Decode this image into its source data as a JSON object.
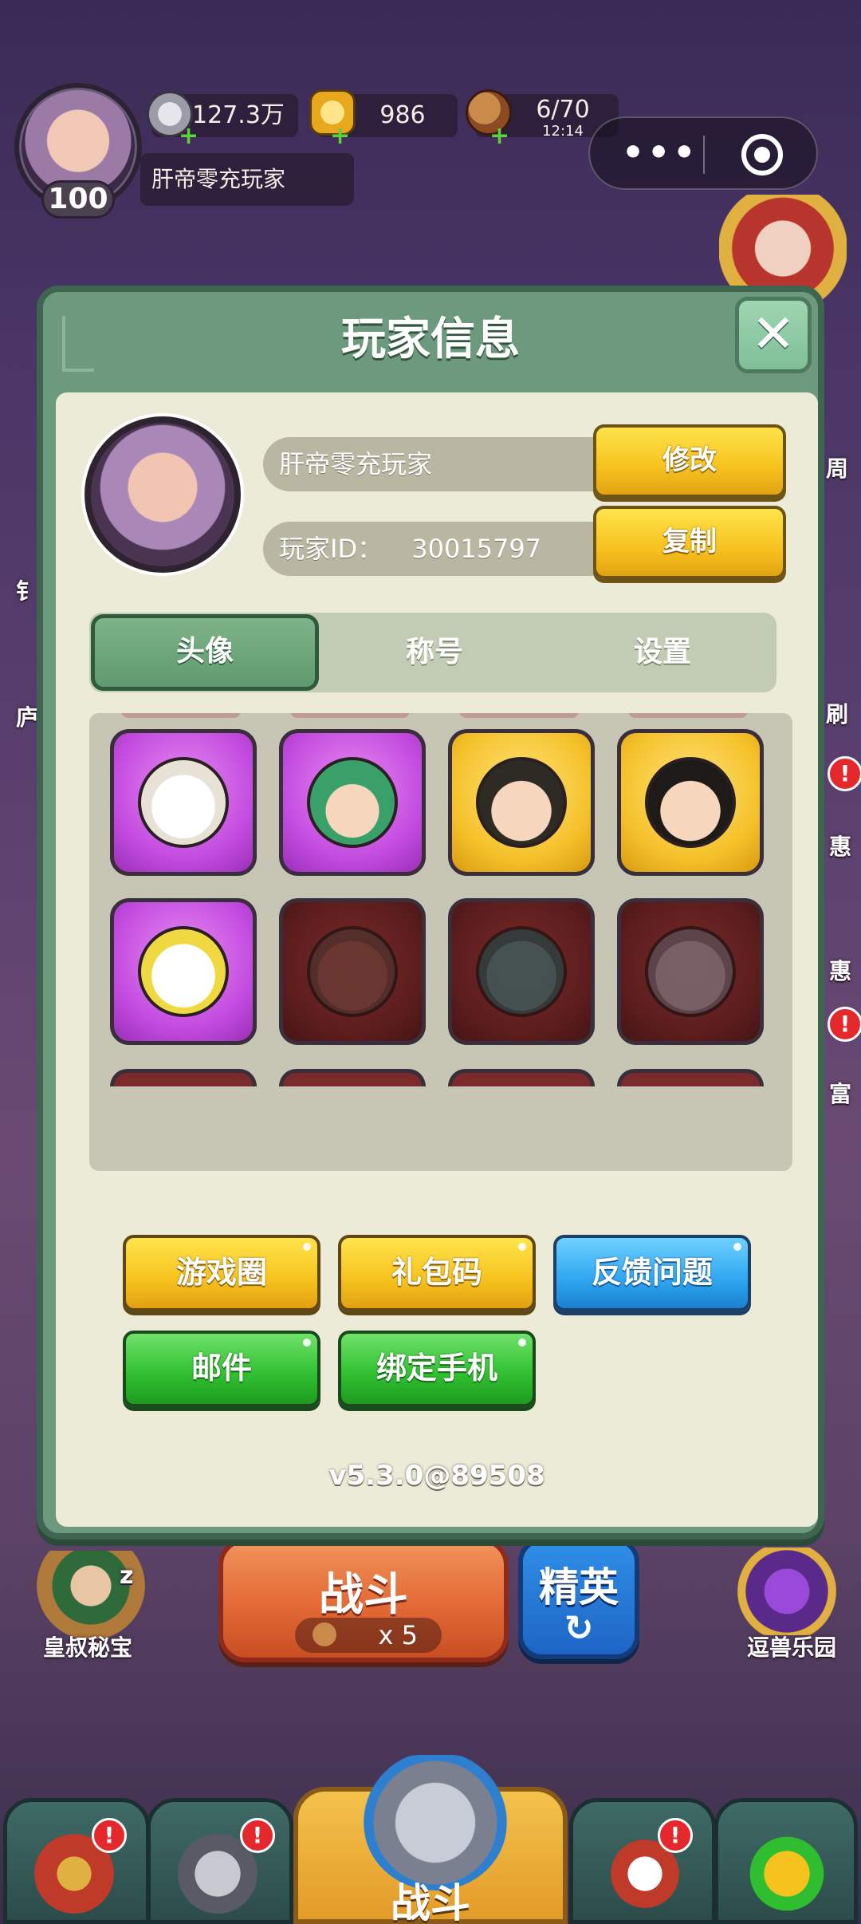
{
  "hud": {
    "level": "100",
    "player_name": "肝帝零充玩家",
    "silver": "127.3万",
    "gold": "986",
    "stamina": "6/70",
    "stamina_timer": "12:14"
  },
  "capsule": {
    "more_icon": "more-dots-icon",
    "close_icon": "target-circle-icon"
  },
  "side": {
    "left_bottom_label": "皇叔秘宝",
    "left_bottom_sleep": "z",
    "right_bottom_label": "逗兽乐园",
    "right_partial_1": "周",
    "right_partial_2": "刷",
    "right_partial_3": "惠",
    "right_partial_4": "惠",
    "right_partial_5": "富",
    "left_partial_1": "钅",
    "left_partial_2": "庐"
  },
  "modal": {
    "title": "玩家信息",
    "close_label": "✕",
    "profile": {
      "name": "肝帝零充玩家",
      "id_label": "玩家ID：",
      "id_value": "30015797",
      "modify_label": "修改",
      "copy_label": "复制"
    },
    "tabs": [
      {
        "label": "头像",
        "active": true
      },
      {
        "label": "称号",
        "active": false
      },
      {
        "label": "设置",
        "active": false
      }
    ],
    "avatars": [
      {
        "name": "goose-avatar",
        "rarity": "purple",
        "locked": false
      },
      {
        "name": "green-hood-avatar",
        "rarity": "purple",
        "locked": false
      },
      {
        "name": "headband-avatar",
        "rarity": "gold",
        "locked": false
      },
      {
        "name": "sunglasses-avatar",
        "rarity": "gold",
        "locked": false
      },
      {
        "name": "rabbit-avatar",
        "rarity": "purple",
        "locked": false
      },
      {
        "name": "warrior-avatar",
        "rarity": "red",
        "locked": true
      },
      {
        "name": "dragon-avatar",
        "rarity": "red",
        "locked": true
      },
      {
        "name": "king-avatar",
        "rarity": "red",
        "locked": true
      }
    ],
    "actions": {
      "game_circle": "游戏圈",
      "gift_code": "礼包码",
      "feedback": "反馈问题",
      "mail": "邮件",
      "bind_phone": "绑定手机"
    },
    "version": "v5.3.0@89508"
  },
  "bottom": {
    "battle_label": "战斗",
    "battle_cost": "x 5",
    "elite_label": "精英",
    "elite_refresh": "↻",
    "center_tab_label": "战斗",
    "badge": "!"
  },
  "colors": {
    "modal_frame": "#6d9a7e",
    "modal_inner": "#ecebd8",
    "accent_yellow": "#f6c21e",
    "accent_blue": "#2ea6f0",
    "accent_green": "#2fbe2f"
  }
}
